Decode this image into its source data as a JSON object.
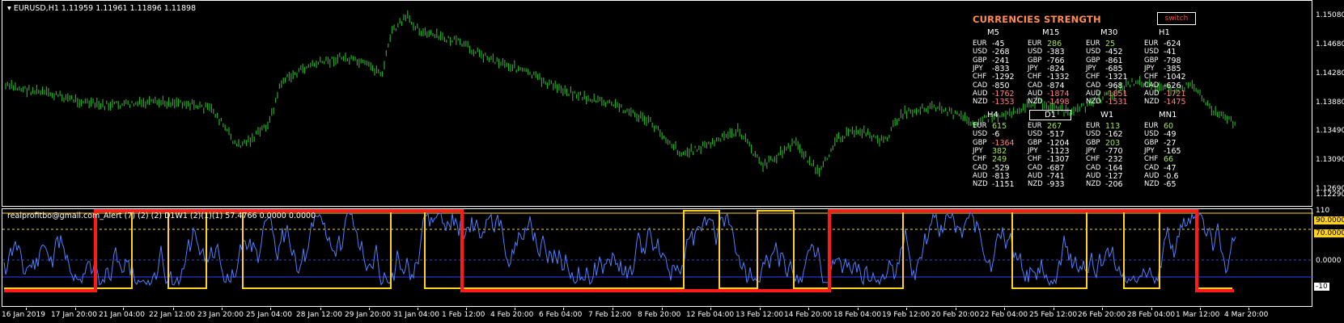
{
  "chart": {
    "symbol_header": "EURUSD,H1  1.11959 1.11961 1.11896 1.11898",
    "price_axis": [
      "1.15080",
      "1.14680",
      "1.14280",
      "1.13880",
      "1.13490",
      "1.13090",
      "1.12690",
      "1.12290"
    ],
    "time_axis": [
      "16 Jan 2019",
      "17 Jan 20:00",
      "21 Jan 04:00",
      "22 Jan 12:00",
      "23 Jan 20:00",
      "25 Jan 04:00",
      "28 Jan 12:00",
      "29 Jan 20:00",
      "31 Jan 04:00",
      "1 Feb 12:00",
      "4 Feb 20:00",
      "6 Feb 04:00",
      "7 Feb 12:00",
      "8 Feb 20:00",
      "12 Feb 04:00",
      "13 Feb 12:00",
      "14 Feb 20:00",
      "18 Feb 04:00",
      "19 Feb 12:00",
      "20 Feb 20:00",
      "22 Feb 04:00",
      "25 Feb 12:00",
      "26 Feb 20:00",
      "28 Feb 04:00",
      "1 Mar 12:00",
      "4 Mar 20:00"
    ],
    "candle_color": "#22a822"
  },
  "indicator": {
    "label": "realprofitbo@gmail.com_Alert (7) (2) (2) D1W1  (2)(1)(1) 57.4766 0.0000 0.0000",
    "axis": [
      "110",
      "90.0000",
      "70.0000",
      "0.0000",
      "-10"
    ],
    "colors": {
      "line": "#4f7fff",
      "red": "#ff1a1a",
      "yellow": "#ffd21f"
    }
  },
  "strength": {
    "title": "CURRENCIES STRENGTH",
    "switch_label": "switch",
    "timeframes": [
      {
        "name": "M5",
        "rows": [
          [
            "EUR",
            "-45"
          ],
          [
            "USD",
            "-268"
          ],
          [
            "GBP",
            "-241"
          ],
          [
            "JPY",
            "-833"
          ],
          [
            "CHF",
            "-1292"
          ],
          [
            "CAD",
            "-850"
          ],
          [
            "AUD",
            "-1762"
          ],
          [
            "NZD",
            "-1353"
          ]
        ]
      },
      {
        "name": "M15",
        "rows": [
          [
            "EUR",
            "286"
          ],
          [
            "USD",
            "-383"
          ],
          [
            "GBP",
            "-766"
          ],
          [
            "JPY",
            "-824"
          ],
          [
            "CHF",
            "-1332"
          ],
          [
            "CAD",
            "-874"
          ],
          [
            "AUD",
            "-1874"
          ],
          [
            "NZD",
            "-1498"
          ]
        ]
      },
      {
        "name": "M30",
        "rows": [
          [
            "EUR",
            "25"
          ],
          [
            "USD",
            "-452"
          ],
          [
            "GBP",
            "-861"
          ],
          [
            "JPY",
            "-685"
          ],
          [
            "CHF",
            "-1321"
          ],
          [
            "CAD",
            "-968"
          ],
          [
            "AUD",
            "-1851"
          ],
          [
            "NZD",
            "-1531"
          ]
        ]
      },
      {
        "name": "H1",
        "rows": [
          [
            "EUR",
            "-624"
          ],
          [
            "USD",
            "-41"
          ],
          [
            "GBP",
            "-798"
          ],
          [
            "JPY",
            "-385"
          ],
          [
            "CHF",
            "-1042"
          ],
          [
            "CAD",
            "-626"
          ],
          [
            "AUD",
            "-1721"
          ],
          [
            "NZD",
            "-1475"
          ]
        ]
      },
      {
        "name": "H4",
        "rows": [
          [
            "EUR",
            "615"
          ],
          [
            "USD",
            "-6"
          ],
          [
            "GBP",
            "-1364"
          ],
          [
            "JPY",
            "382"
          ],
          [
            "CHF",
            "249"
          ],
          [
            "CAD",
            "-529"
          ],
          [
            "AUD",
            "-813"
          ],
          [
            "NZD",
            "-1151"
          ]
        ]
      },
      {
        "name": "D1",
        "rows": [
          [
            "EUR",
            "267"
          ],
          [
            "USD",
            "-517"
          ],
          [
            "GBP",
            "-1204"
          ],
          [
            "JPY",
            "-1123"
          ],
          [
            "CHF",
            "-1307"
          ],
          [
            "CAD",
            "-687"
          ],
          [
            "AUD",
            "-741"
          ],
          [
            "NZD",
            "-933"
          ]
        ]
      },
      {
        "name": "W1",
        "rows": [
          [
            "EUR",
            "113"
          ],
          [
            "USD",
            "-162"
          ],
          [
            "GBP",
            "203"
          ],
          [
            "JPY",
            "-770"
          ],
          [
            "CHF",
            "-232"
          ],
          [
            "CAD",
            "-164"
          ],
          [
            "AUD",
            "-127"
          ],
          [
            "NZD",
            "-206"
          ]
        ]
      },
      {
        "name": "MN1",
        "rows": [
          [
            "EUR",
            "60"
          ],
          [
            "USD",
            "-49"
          ],
          [
            "GBP",
            "-27"
          ],
          [
            "JPY",
            "-165"
          ],
          [
            "CHF",
            "66"
          ],
          [
            "CAD",
            "-47"
          ],
          [
            "AUD",
            "-0.6"
          ],
          [
            "NZD",
            "-65"
          ]
        ]
      }
    ]
  }
}
